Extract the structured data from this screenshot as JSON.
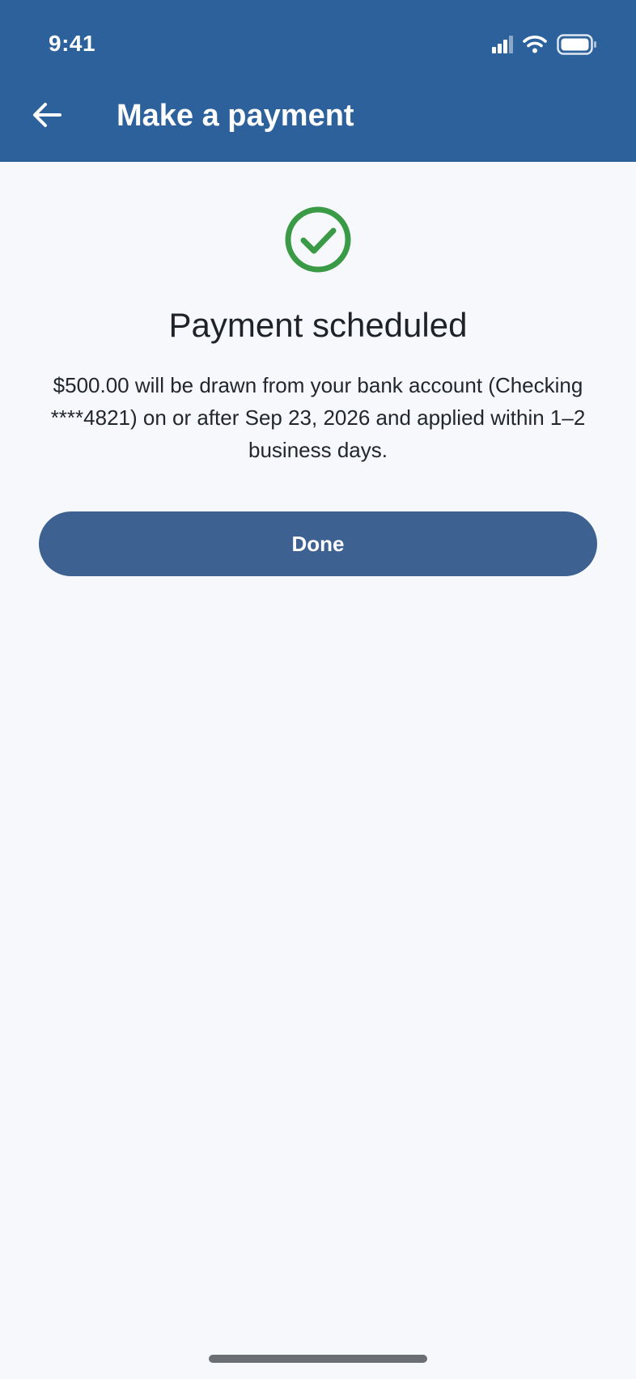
{
  "status_bar": {
    "time": "9:41",
    "icons": [
      "signal-icon",
      "wifi-icon",
      "battery-icon"
    ]
  },
  "app_bar": {
    "title": "Make a payment",
    "back_icon": "arrow-left-icon"
  },
  "confirmation": {
    "icon": "check-circle-icon",
    "heading": "Payment scheduled",
    "message": "$500.00 will be drawn from your bank account (Checking ****4821) on or after Sep 23, 2026 and applied within 1–2 business days.",
    "done_label": "Done"
  },
  "colors": {
    "header_bg": "#2d619c",
    "page_bg": "#f6f8fc",
    "success_green": "#3b9a45",
    "button_bg": "#3d6191"
  }
}
